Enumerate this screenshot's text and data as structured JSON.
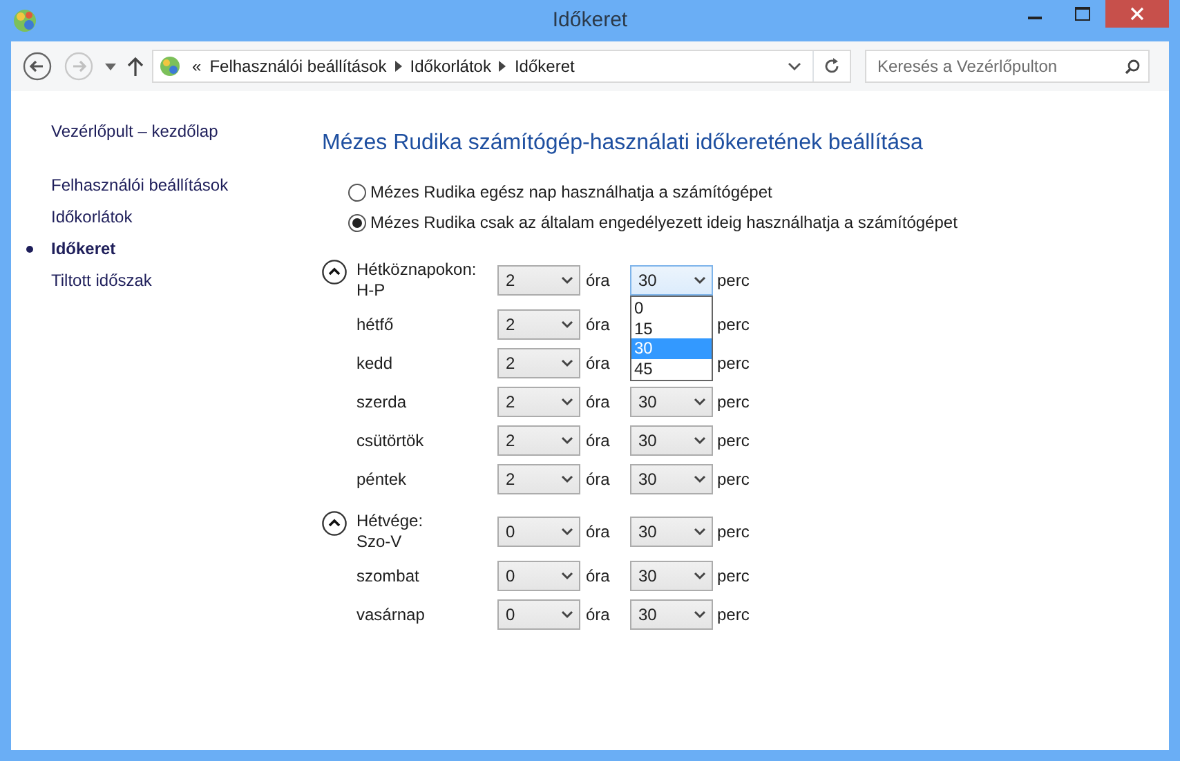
{
  "window": {
    "title": "Időkeret"
  },
  "address": {
    "overflow": "«",
    "breadcrumbs": [
      "Felhasználói beállítások",
      "Időkorlátok",
      "Időkeret"
    ]
  },
  "search": {
    "placeholder": "Keresés a Vezérlőpulton"
  },
  "sidebar": {
    "home": "Vezérlőpult – kezdőlap",
    "items": [
      {
        "label": "Felhasználói beállítások",
        "selected": false
      },
      {
        "label": "Időkorlátok",
        "selected": false
      },
      {
        "label": "Időkeret",
        "selected": true
      },
      {
        "label": "Tiltott időszak",
        "selected": false
      }
    ]
  },
  "heading": "Mézes Rudika számítógép-használati időkeretének beállítása",
  "options": [
    {
      "label": "Mézes Rudika egész nap használhatja a számítógépet",
      "selected": false
    },
    {
      "label": "Mézes Rudika csak az általam engedélyezett ideig használhatja a számítógépet",
      "selected": true
    }
  ],
  "groups": [
    {
      "title": "Hétköznapokon:",
      "range": "H-P",
      "expanded": true,
      "hours": "2",
      "hour_unit": "óra",
      "minutes": "30",
      "minute_unit": "perc",
      "minutes_open": true,
      "minute_menu": [
        {
          "label": "0",
          "selected": false
        },
        {
          "label": "15",
          "selected": false
        },
        {
          "label": "30",
          "selected": true
        },
        {
          "label": "45",
          "selected": false
        }
      ],
      "days": [
        {
          "label": "hétfő",
          "hours": "2",
          "hour_unit": "óra",
          "minute_unit": "perc"
        },
        {
          "label": "kedd",
          "hours": "2",
          "hour_unit": "óra",
          "minute_unit": "perc"
        },
        {
          "label": "szerda",
          "hours": "2",
          "hour_unit": "óra",
          "minutes": "30",
          "minute_unit": "perc"
        },
        {
          "label": "csütörtök",
          "hours": "2",
          "hour_unit": "óra",
          "minutes": "30",
          "minute_unit": "perc"
        },
        {
          "label": "péntek",
          "hours": "2",
          "hour_unit": "óra",
          "minutes": "30",
          "minute_unit": "perc"
        }
      ]
    },
    {
      "title": "Hétvége:",
      "range": "Szo-V",
      "expanded": true,
      "hours": "0",
      "hour_unit": "óra",
      "minutes": "30",
      "minute_unit": "perc",
      "minutes_open": false,
      "days": [
        {
          "label": "szombat",
          "hours": "0",
          "hour_unit": "óra",
          "minutes": "30",
          "minute_unit": "perc"
        },
        {
          "label": "vasárnap",
          "hours": "0",
          "hour_unit": "óra",
          "minutes": "30",
          "minute_unit": "perc"
        }
      ]
    }
  ]
}
